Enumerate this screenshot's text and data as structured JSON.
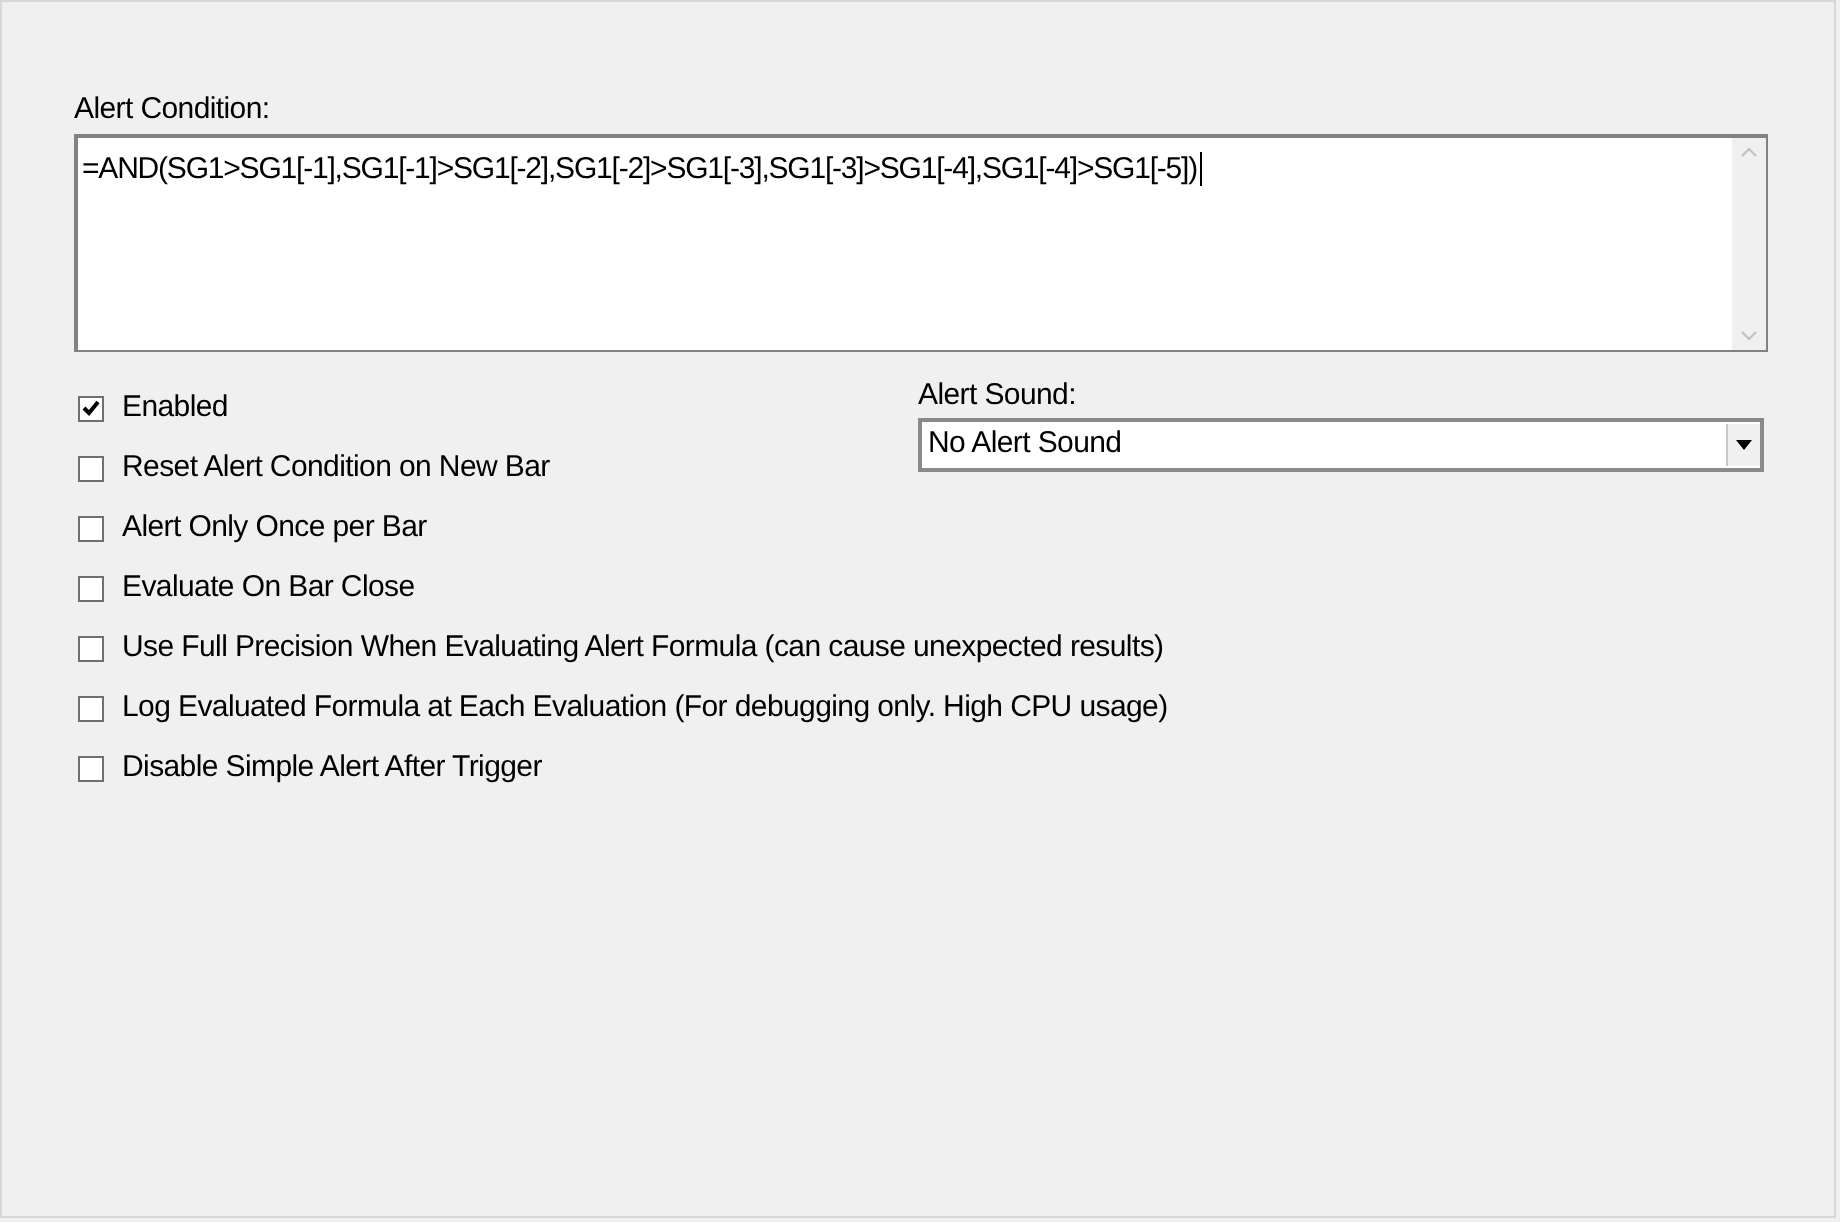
{
  "alert_condition": {
    "label": "Alert Condition:",
    "value": "=AND(SG1>SG1[-1],SG1[-1]>SG1[-2],SG1[-2]>SG1[-3],SG1[-3]>SG1[-4],SG1[-4]>SG1[-5])"
  },
  "options": [
    {
      "label": "Enabled",
      "checked": true
    },
    {
      "label": "Reset Alert Condition on New Bar",
      "checked": false
    },
    {
      "label": "Alert Only Once per Bar",
      "checked": false
    },
    {
      "label": "Evaluate On Bar Close",
      "checked": false
    },
    {
      "label": "Use Full Precision When Evaluating Alert Formula (can cause unexpected results)",
      "checked": false
    },
    {
      "label": "Log Evaluated Formula at Each Evaluation (For debugging only. High CPU usage)",
      "checked": false
    },
    {
      "label": "Disable Simple Alert After Trigger",
      "checked": false
    }
  ],
  "alert_sound": {
    "label": "Alert Sound:",
    "value": "No Alert Sound"
  }
}
